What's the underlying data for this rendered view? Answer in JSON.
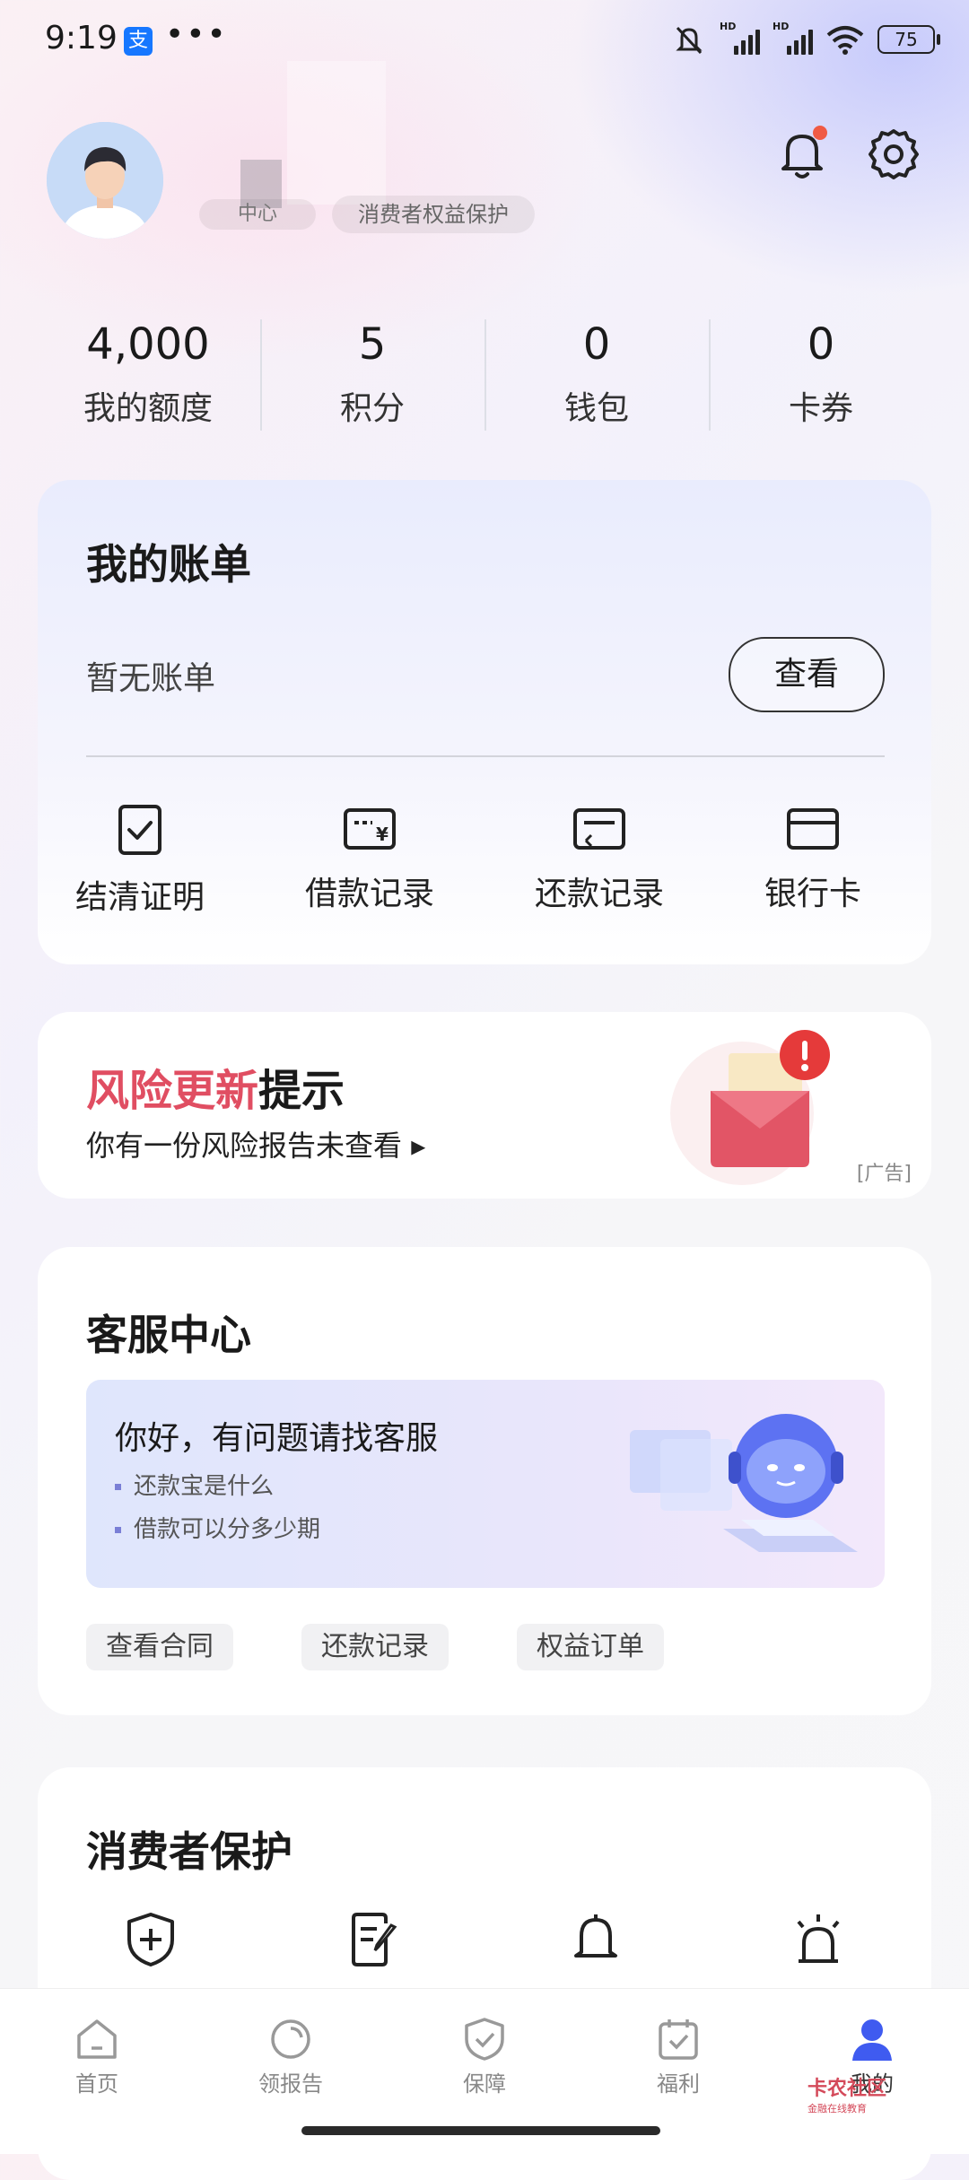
{
  "status_bar": {
    "time": "9:19",
    "alipay_glyph": "支",
    "more": "•••",
    "battery": "75",
    "hd1": "HD",
    "hd2": "HD"
  },
  "profile": {
    "badge1": "中心",
    "badge2": "消费者权益保护"
  },
  "stats": [
    {
      "value": "4,000",
      "label": "我的额度"
    },
    {
      "value": "5",
      "label": "积分"
    },
    {
      "value": "0",
      "label": "钱包"
    },
    {
      "value": "0",
      "label": "卡券"
    }
  ],
  "bill": {
    "title": "我的账单",
    "empty_text": "暂无账单",
    "view_button": "查看",
    "actions": [
      {
        "label": "结清证明",
        "icon": "certificate-icon"
      },
      {
        "label": "借款记录",
        "icon": "loan-record-icon"
      },
      {
        "label": "还款记录",
        "icon": "repay-record-icon"
      },
      {
        "label": "银行卡",
        "icon": "bank-card-icon"
      }
    ]
  },
  "risk": {
    "title_highlight": "风险更新",
    "title_rest": "提示",
    "subtitle": "你有一份风险报告未查看",
    "ad_label": "[广告]"
  },
  "service": {
    "title": "客服中心",
    "banner_title": "你好，有问题请找客服",
    "questions": [
      "还款宝是什么",
      "借款可以分多少期"
    ],
    "chips": [
      "查看合同",
      "还款记录",
      "权益订单"
    ]
  },
  "consumer": {
    "title": "消费者保护",
    "icons": [
      "shield-plus-icon",
      "edit-doc-icon",
      "bell-icon",
      "alarm-icon"
    ]
  },
  "tabbar": [
    {
      "label": "首页",
      "icon": "home-icon"
    },
    {
      "label": "领报告",
      "icon": "report-icon"
    },
    {
      "label": "保障",
      "icon": "shield-check-icon"
    },
    {
      "label": "福利",
      "icon": "calendar-check-icon"
    },
    {
      "label": "我的",
      "icon": "user-icon"
    }
  ],
  "watermark": {
    "main": "卡农社区",
    "sub": "金融在线教育"
  },
  "colors": {
    "accent_red": "#e04e62",
    "tab_active": "#3f5bf0",
    "notification_dot": "#f05a44"
  }
}
